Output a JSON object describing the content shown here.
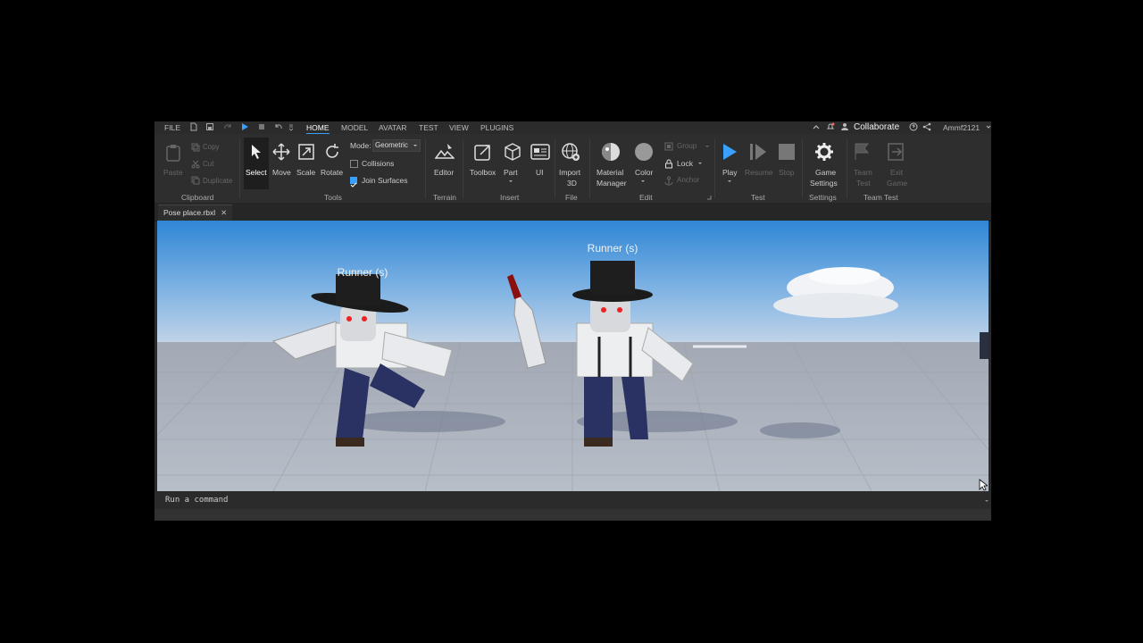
{
  "menubar": {
    "file": "FILE",
    "tabs": [
      "HOME",
      "MODEL",
      "AVATAR",
      "TEST",
      "VIEW",
      "PLUGINS"
    ],
    "active_tab": "HOME",
    "collaborate": "Collaborate",
    "username": "Ammf2121"
  },
  "clipboard": {
    "paste": "Paste",
    "copy": "Copy",
    "cut": "Cut",
    "duplicate": "Duplicate",
    "group_label": "Clipboard"
  },
  "tools": {
    "select": "Select",
    "move": "Move",
    "scale": "Scale",
    "rotate": "Rotate",
    "mode_label": "Mode:",
    "mode_value": "Geometric",
    "collisions": "Collisions",
    "join_surfaces": "Join Surfaces",
    "group_label": "Tools"
  },
  "terrain": {
    "editor": "Editor",
    "group_label": "Terrain"
  },
  "insert": {
    "toolbox": "Toolbox",
    "part": "Part",
    "ui": "UI",
    "group_label": "Insert"
  },
  "file": {
    "import_line1": "Import",
    "import_line2": "3D",
    "group_label": "File"
  },
  "edit": {
    "material_line1": "Material",
    "material_line2": "Manager",
    "color": "Color",
    "group": "Group",
    "lock": "Lock",
    "anchor": "Anchor",
    "group_label": "Edit"
  },
  "test": {
    "play": "Play",
    "resume": "Resume",
    "stop": "Stop",
    "group_label": "Test"
  },
  "settings": {
    "game_line1": "Game",
    "game_line2": "Settings",
    "group_label": "Settings"
  },
  "teamtest": {
    "team_line1": "Team",
    "team_line2": "Test",
    "exit_line1": "Exit",
    "exit_line2": "Game",
    "group_label": "Team Test"
  },
  "document_tab": "Pose place.rbxl",
  "viewport": {
    "nametag_left": "Runner (s)",
    "nametag_right": "Runner (s)"
  },
  "command_bar": {
    "placeholder": "Run a command"
  },
  "colors": {
    "accent": "#3aa0ff",
    "panel": "#2e2e2e",
    "sky_top": "#3b8fd8",
    "floor": "#8d97a8"
  }
}
